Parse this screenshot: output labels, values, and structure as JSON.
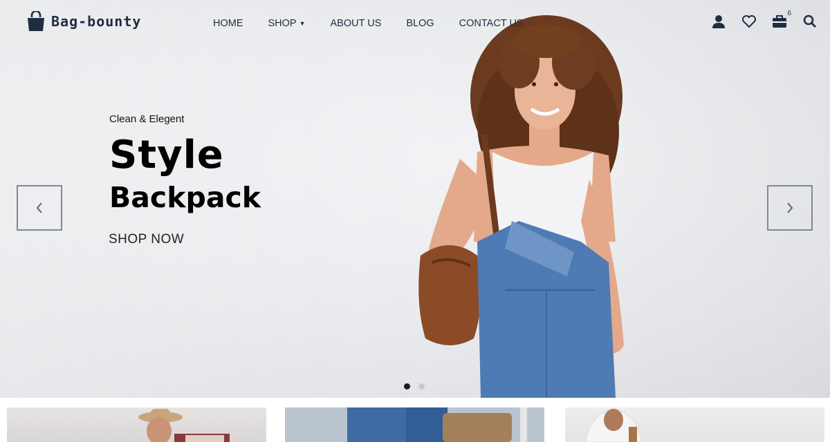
{
  "brand": {
    "name": "Bag-bounty"
  },
  "nav": {
    "items": [
      {
        "label": "HOME"
      },
      {
        "label": "SHOP",
        "has_dropdown": true
      },
      {
        "label": "ABOUT US"
      },
      {
        "label": "BLOG"
      },
      {
        "label": "CONTACT US"
      }
    ]
  },
  "header_icons": {
    "account": "user-icon",
    "wishlist": "heart-icon",
    "cart": "briefcase-cart-icon",
    "cart_count": "6",
    "search": "search-icon"
  },
  "hero": {
    "eyebrow": "Clean & Elegent",
    "title_line1": "Style",
    "title_line2": "Backpack",
    "cta": "SHOP NOW",
    "slides_total": 2,
    "active_slide": 1
  },
  "colors": {
    "nav_text": "#1f2d42",
    "arrow_border": "#7f8799",
    "dot_active": "#1b1b1b",
    "dot_inactive": "#c7c9ce"
  }
}
